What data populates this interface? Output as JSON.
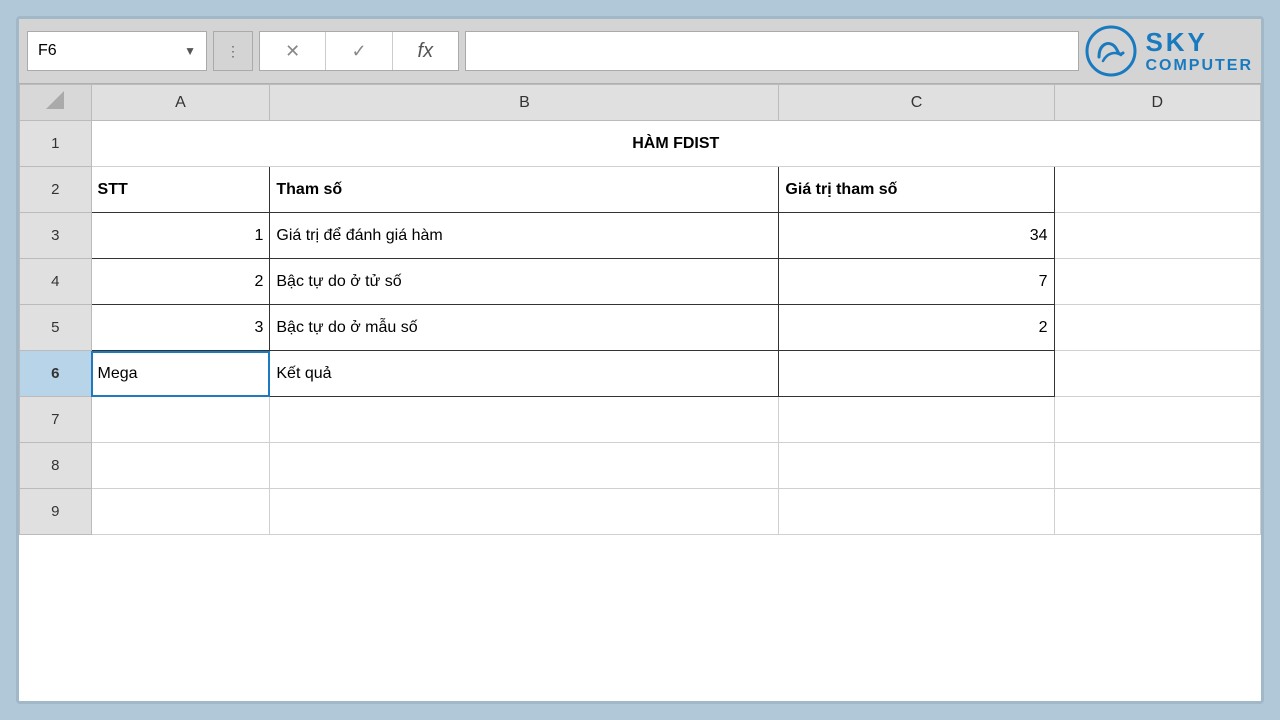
{
  "formula_bar": {
    "cell_ref": "F6",
    "dots_icon": "⋮",
    "cancel_label": "✕",
    "confirm_label": "✓",
    "fx_label": "fx"
  },
  "logo": {
    "sky_line1": "SKY",
    "sky_line2": "COMPUTER"
  },
  "columns": [
    "A",
    "B",
    "C",
    "D"
  ],
  "rows": [
    {
      "row_num": "1",
      "cells": [
        {
          "col": "A",
          "value": "",
          "span": 3,
          "class": "title-cell cell-bold",
          "text": "HÀM FDIST"
        }
      ]
    },
    {
      "row_num": "2",
      "cells": [
        {
          "col": "A",
          "value": "STT"
        },
        {
          "col": "B",
          "value": "Tham số"
        },
        {
          "col": "C",
          "value": "Giá trị tham số"
        },
        {
          "col": "D",
          "value": ""
        }
      ]
    },
    {
      "row_num": "3",
      "cells": [
        {
          "col": "A",
          "value": "1",
          "align": "right"
        },
        {
          "col": "B",
          "value": "Giá trị để đánh giá hàm"
        },
        {
          "col": "C",
          "value": "34",
          "align": "right"
        },
        {
          "col": "D",
          "value": ""
        }
      ]
    },
    {
      "row_num": "4",
      "cells": [
        {
          "col": "A",
          "value": "2",
          "align": "right"
        },
        {
          "col": "B",
          "value": "Bậc tự do ở tử số"
        },
        {
          "col": "C",
          "value": "7",
          "align": "right"
        },
        {
          "col": "D",
          "value": ""
        }
      ]
    },
    {
      "row_num": "5",
      "cells": [
        {
          "col": "A",
          "value": "3",
          "align": "right"
        },
        {
          "col": "B",
          "value": "Bậc tự do ở mẫu số"
        },
        {
          "col": "C",
          "value": "2",
          "align": "right"
        },
        {
          "col": "D",
          "value": ""
        }
      ]
    },
    {
      "row_num": "6",
      "cells": [
        {
          "col": "A",
          "value": "Mega",
          "active": true
        },
        {
          "col": "B",
          "value": "Kết quả"
        },
        {
          "col": "C",
          "value": ""
        },
        {
          "col": "D",
          "value": ""
        }
      ]
    },
    {
      "row_num": "7",
      "cells": [
        {
          "col": "A",
          "value": ""
        },
        {
          "col": "B",
          "value": ""
        },
        {
          "col": "C",
          "value": ""
        },
        {
          "col": "D",
          "value": ""
        }
      ]
    },
    {
      "row_num": "8",
      "cells": [
        {
          "col": "A",
          "value": ""
        },
        {
          "col": "B",
          "value": ""
        },
        {
          "col": "C",
          "value": ""
        },
        {
          "col": "D",
          "value": ""
        }
      ]
    },
    {
      "row_num": "9",
      "cells": [
        {
          "col": "A",
          "value": ""
        },
        {
          "col": "B",
          "value": ""
        },
        {
          "col": "C",
          "value": ""
        },
        {
          "col": "D",
          "value": ""
        }
      ]
    }
  ]
}
